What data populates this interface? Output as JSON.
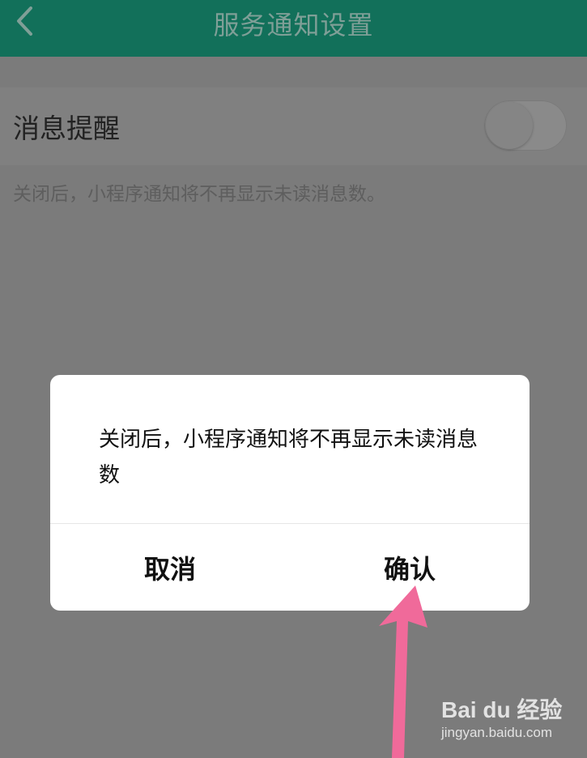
{
  "header": {
    "title": "服务通知设置",
    "back_icon": "chevron-left-icon",
    "color": "#12705a"
  },
  "setting": {
    "label": "消息提醒",
    "toggle_on": false,
    "hint": "关闭后，小程序通知将不再显示未读消息数。"
  },
  "dialog": {
    "message": "关闭后，小程序通知将不再显示未读消息数",
    "cancel_label": "取消",
    "confirm_label": "确认"
  },
  "annotation": {
    "arrow_color": "#f06a9a"
  },
  "watermark": {
    "brand": "Bai du 经验",
    "url": "jingyan.baidu.com"
  }
}
